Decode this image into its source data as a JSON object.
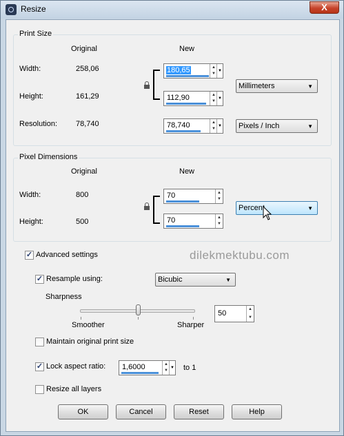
{
  "window": {
    "title": "Resize",
    "close_label": "X"
  },
  "print_size": {
    "label": "Print Size",
    "col_original": "Original",
    "col_new": "New",
    "width_label": "Width:",
    "width_original": "258,06",
    "width_new": "180,65",
    "height_label": "Height:",
    "height_original": "161,29",
    "height_new": "112,90",
    "resolution_label": "Resolution:",
    "resolution_original": "78,740",
    "resolution_new": "78,740",
    "units": "Millimeters",
    "resolution_units": "Pixels / Inch"
  },
  "pixel_dimensions": {
    "label": "Pixel Dimensions",
    "col_original": "Original",
    "col_new": "New",
    "width_label": "Width:",
    "width_original": "800",
    "width_new": "70",
    "height_label": "Height:",
    "height_original": "500",
    "height_new": "70",
    "units": "Percent"
  },
  "advanced": {
    "advanced_settings": {
      "label": "Advanced settings",
      "checked": true
    },
    "resample": {
      "label": "Resample using:",
      "checked": true,
      "method": "Bicubic"
    },
    "sharpness": {
      "label": "Sharpness",
      "min_label": "Smoother",
      "max_label": "Sharper",
      "value": "50"
    },
    "maintain_print_size": {
      "label": "Maintain original print size",
      "checked": false
    },
    "lock_aspect": {
      "label": "Lock aspect ratio:",
      "checked": true,
      "value": "1,6000",
      "suffix": "to 1"
    },
    "resize_all_layers": {
      "label": "Resize all layers",
      "checked": false
    }
  },
  "watermark": "dilekmektubu.com",
  "buttons": {
    "ok": "OK",
    "cancel": "Cancel",
    "reset": "Reset",
    "help": "Help"
  },
  "check_glyph": "✓",
  "icons": {
    "up": "▲",
    "down": "▼",
    "dropdown": "▼"
  }
}
